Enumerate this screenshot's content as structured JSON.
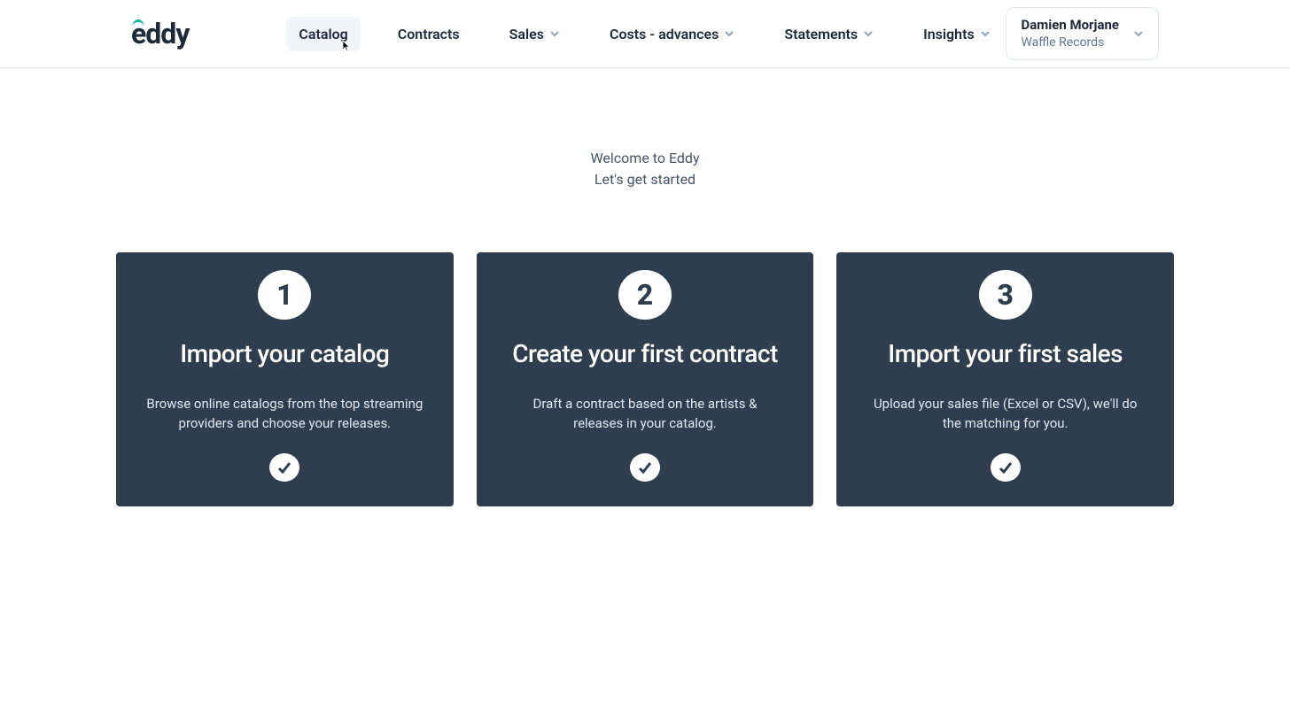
{
  "logo": "eddy",
  "nav": {
    "items": [
      {
        "label": "Catalog",
        "active": true,
        "dropdown": false
      },
      {
        "label": "Contracts",
        "active": false,
        "dropdown": false
      },
      {
        "label": "Sales",
        "active": false,
        "dropdown": true
      },
      {
        "label": "Costs - advances",
        "active": false,
        "dropdown": true
      },
      {
        "label": "Statements",
        "active": false,
        "dropdown": true
      },
      {
        "label": "Insights",
        "active": false,
        "dropdown": true
      }
    ]
  },
  "user": {
    "name": "Damien Morjane",
    "org": "Waffle Records"
  },
  "welcome": {
    "line1": "Welcome to Eddy",
    "line2": "Let's get started"
  },
  "cards": [
    {
      "number": "1",
      "title": "Import your catalog",
      "desc": "Browse online catalogs from the top streaming providers and choose your releases."
    },
    {
      "number": "2",
      "title": "Create your first contract",
      "desc": "Draft a contract based on the artists & releases in your catalog."
    },
    {
      "number": "3",
      "title": "Import your first sales",
      "desc": "Upload your sales file (Excel or CSV), we'll do the matching for you."
    }
  ]
}
